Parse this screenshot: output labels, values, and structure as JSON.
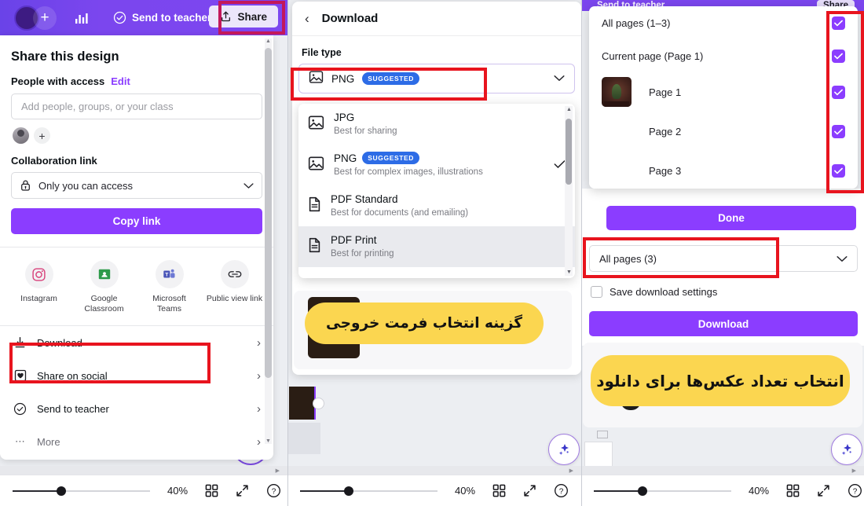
{
  "topbar": {
    "send_to_teacher": "Send to teacher",
    "share": "Share",
    "plus": "+",
    "avatar_icon": "user-avatar",
    "stats_icon": "bar-chart-icon",
    "check_icon": "check-circle-icon",
    "share_icon": "share-upload-icon"
  },
  "share_panel": {
    "title": "Share this design",
    "people_with_access": "People with access",
    "edit": "Edit",
    "input_placeholder": "Add people, groups, or your class",
    "collaboration_link_label": "Collaboration link",
    "access_value": "Only you can access",
    "lock_icon": "lock-icon",
    "copy_link": "Copy link",
    "socials": [
      {
        "label": "Instagram",
        "icon": "instagram-icon"
      },
      {
        "label": "Google Classroom",
        "icon": "google-classroom-icon"
      },
      {
        "label": "Microsoft Teams",
        "icon": "microsoft-teams-icon"
      },
      {
        "label": "Public view link",
        "icon": "link-chain-icon"
      }
    ],
    "menu": [
      {
        "label": "Download",
        "icon": "download-icon"
      },
      {
        "label": "Share on social",
        "icon": "heart-square-icon"
      },
      {
        "label": "Send to teacher",
        "icon": "check-circle-icon"
      },
      {
        "label": "More",
        "icon": "ellipsis-icon"
      }
    ]
  },
  "download_panel": {
    "header": "Download",
    "back_icon": "chevron-left-icon",
    "file_type_label": "File type",
    "selected": {
      "name": "PNG",
      "badge": "SUGGESTED",
      "icon": "image-icon"
    },
    "options": [
      {
        "name": "JPG",
        "badge": "",
        "desc": "Best for sharing",
        "icon": "image-icon",
        "checked": false,
        "highlighted": false
      },
      {
        "name": "PNG",
        "badge": "SUGGESTED",
        "desc": "Best for complex images, illustrations",
        "icon": "image-icon",
        "checked": true,
        "highlighted": false
      },
      {
        "name": "PDF Standard",
        "badge": "",
        "desc": "Best for documents (and emailing)",
        "icon": "document-icon",
        "checked": false,
        "highlighted": false
      },
      {
        "name": "PDF Print",
        "badge": "",
        "desc": "Best for printing",
        "icon": "document-icon",
        "checked": false,
        "highlighted": true
      }
    ]
  },
  "pages_panel": {
    "rows": [
      {
        "label": "All pages (1–3)",
        "checked": true,
        "thumb": false
      },
      {
        "label": "Current page (Page 1)",
        "checked": true,
        "thumb": false
      },
      {
        "label": "Page 1",
        "checked": true,
        "thumb": true
      },
      {
        "label": "Page 2",
        "checked": true,
        "thumb": false
      },
      {
        "label": "Page 3",
        "checked": true,
        "thumb": false
      }
    ],
    "done": "Done",
    "select_value": "All pages (3)",
    "save_settings": "Save download settings",
    "download": "Download"
  },
  "callouts": {
    "one": "گزینه انتخاب فرمت خروجی",
    "two": "انتخاب تعداد عکس‌ها برای دانلود"
  },
  "bottombar": {
    "zoom_left": "40%",
    "zoom_mid": "40%",
    "zoom_right": "40%",
    "grid_icon": "grid-view-icon",
    "expand_icon": "expand-arrows-icon",
    "help_icon": "help-circle-icon"
  },
  "colors": {
    "brand_purple": "#8B3DFF",
    "topbar_purple": "#7B46EE",
    "annotation_red": "#E8141E",
    "callout_yellow": "#FBD650",
    "badge_blue": "#2D6CE6"
  }
}
